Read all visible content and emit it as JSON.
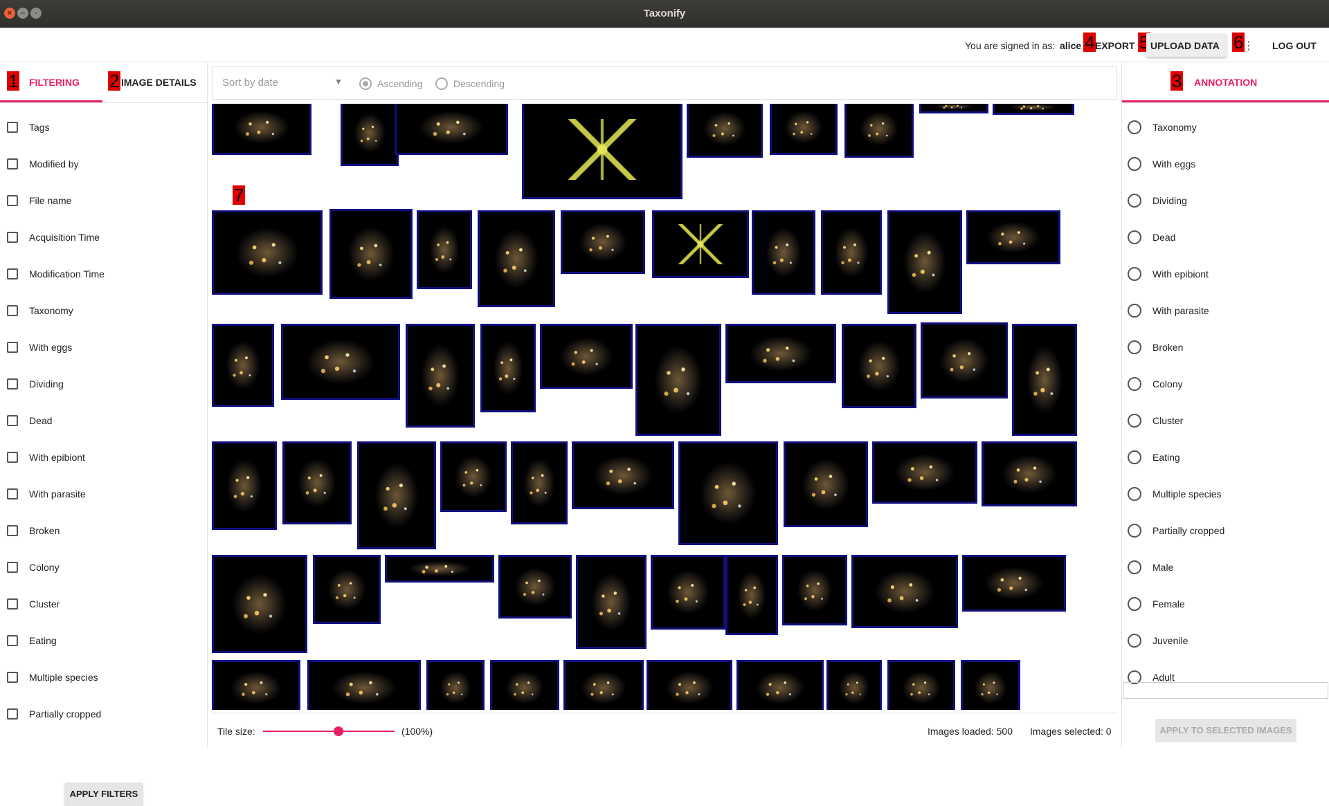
{
  "window": {
    "title": "Taxonify"
  },
  "header": {
    "signed_in_label": "You are signed in as:",
    "username": "alice",
    "export_label": "EXPORT",
    "upload_label": "UPLOAD DATA",
    "logout_label": "LOG OUT",
    "more_icon": "more-vert-icon"
  },
  "markers": [
    "1",
    "2",
    "3",
    "4",
    "5",
    "6",
    "7"
  ],
  "left_panel": {
    "tabs": [
      {
        "label": "FILTERING",
        "active": true
      },
      {
        "label": "IMAGE DETAILS",
        "active": false
      }
    ],
    "filters": [
      "Tags",
      "Modified by",
      "File name",
      "Acquisition Time",
      "Modification Time",
      "Taxonomy",
      "With eggs",
      "Dividing",
      "Dead",
      "With epibiont",
      "With parasite",
      "Broken",
      "Colony",
      "Cluster",
      "Eating",
      "Multiple species",
      "Partially cropped"
    ],
    "apply_label": "APPLY FILTERS"
  },
  "sort": {
    "placeholder": "Sort by date",
    "ascending_label": "Ascending",
    "descending_label": "Descending",
    "selected": "Ascending"
  },
  "bottom": {
    "tile_size_label": "Tile size:",
    "tile_size_value": "(100%)",
    "tile_size_fraction": 0.5,
    "images_loaded": "Images loaded: 500",
    "images_selected": "Images selected: 0"
  },
  "right_panel": {
    "tab_label": "ANNOTATION",
    "options": [
      "Taxonomy",
      "With eggs",
      "Dividing",
      "Dead",
      "With epibiont",
      "With parasite",
      "Broken",
      "Colony",
      "Cluster",
      "Eating",
      "Multiple species",
      "Partially cropped",
      "Male",
      "Female",
      "Juvenile",
      "Adult"
    ],
    "apply_label": "APPLY TO SELECTED IMAGES"
  },
  "colors": {
    "accent": "#e91e63",
    "tile_border": "#10107f",
    "marker": "#e10000"
  }
}
